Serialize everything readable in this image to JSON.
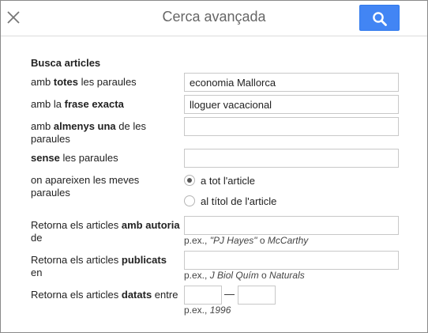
{
  "header": {
    "title": "Cerca avançada",
    "close_icon": "close-icon",
    "search_icon": "search-icon",
    "accent": "#4285f4"
  },
  "form": {
    "section_title": "Busca articles",
    "all_words": {
      "pre": "amb ",
      "bold": "totes",
      "post": " les paraules",
      "value": "economia Mallorca"
    },
    "exact_phrase": {
      "pre": "amb la ",
      "bold": "frase exacta",
      "post": "",
      "value": "lloguer vacacional"
    },
    "at_least_one": {
      "pre": "amb ",
      "bold": "almenys una",
      "post": " de les paraules",
      "value": ""
    },
    "without": {
      "pre": "",
      "bold": "sense",
      "post": " les paraules",
      "value": ""
    },
    "occurrence": {
      "label": "on apareixen les meves paraules",
      "options": [
        "a tot l'article",
        "al títol de l'article"
      ],
      "selected": "a tot l'article"
    },
    "author": {
      "pre": "Retorna els articles ",
      "bold": "amb autoria",
      "post": " de",
      "value": "",
      "hint_pre": "p.ex., ",
      "hint_ex1": "\"PJ Hayes\"",
      "hint_mid": " o ",
      "hint_ex2": "McCarthy"
    },
    "published": {
      "pre": "Retorna els articles ",
      "bold": "publicats",
      "post": " en",
      "value": "",
      "hint_pre": "p.ex., ",
      "hint_ex1": "J Biol Quím",
      "hint_mid": " o ",
      "hint_ex2": "Naturals"
    },
    "dated": {
      "pre": "Retorna els articles ",
      "bold": "datats",
      "post": " entre",
      "from_value": "",
      "to_value": "",
      "separator": "—",
      "hint_pre": "p.ex., ",
      "hint_ex1": "1996"
    }
  }
}
